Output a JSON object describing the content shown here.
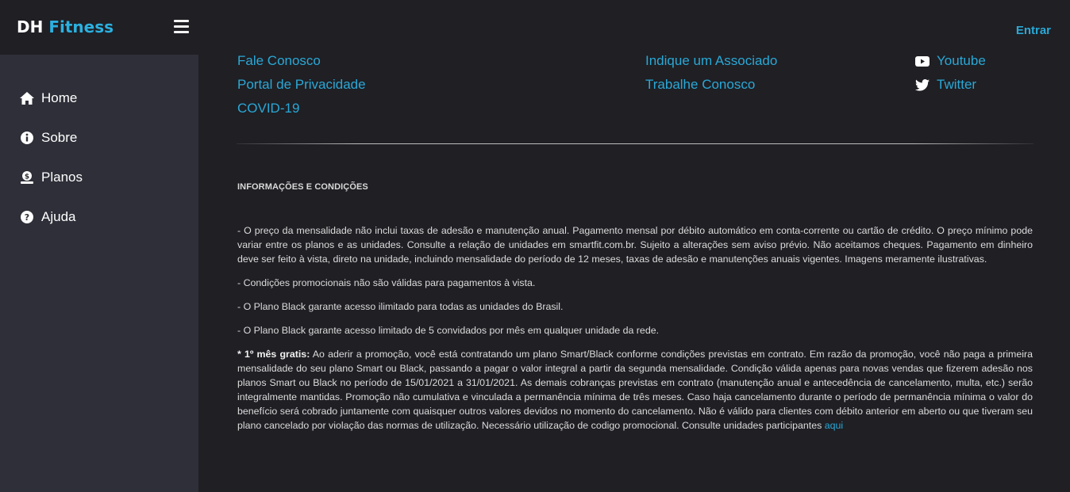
{
  "brand": {
    "part1": "DH",
    "part2": "Fitness"
  },
  "header": {
    "login_label": "Entrar"
  },
  "sidebar": {
    "items": [
      {
        "label": "Home",
        "icon": "home-icon"
      },
      {
        "label": "Sobre",
        "icon": "info-icon"
      },
      {
        "label": "Planos",
        "icon": "money-icon"
      },
      {
        "label": "Ajuda",
        "icon": "question-icon"
      }
    ]
  },
  "footer_links": {
    "col1": [
      "Fale Conosco",
      "Portal de Privacidade",
      "COVID-19"
    ],
    "col2": [
      "Indique um Associado",
      "Trabalhe Conosco"
    ],
    "social": [
      {
        "label": "Youtube",
        "icon": "youtube-icon"
      },
      {
        "label": "Twitter",
        "icon": "twitter-icon"
      }
    ]
  },
  "info": {
    "title": "INFORMAÇÕES E CONDIÇÕES",
    "p1": "- O preço da mensalidade não inclui taxas de adesão e manutenção anual. Pagamento mensal por débito automático em conta-corrente ou cartão de crédito. O preço mínimo pode variar entre os planos e as unidades. Consulte a relação de unidades em smartfit.com.br. Sujeito a alterações sem aviso prévio. Não aceitamos cheques. Pagamento em dinheiro deve ser feito à vista, direto na unidade, incluindo mensalidade do período de 12 meses, taxas de adesão e manutenções anuais vigentes. Imagens meramente ilustrativas.",
    "p2": "- Condições promocionais não são válidas para pagamentos à vista.",
    "p3": "- O Plano Black garante acesso ilimitado para todas as unidades do Brasil.",
    "p4": "- O Plano Black garante acesso limitado de 5 convidados por mês em qualquer unidade da rede.",
    "p5_strong": "* 1º mês gratis:",
    "p5_text": " Ao aderir a promoção, você está contratando um plano Smart/Black conforme condições previstas em contrato. Em razão da promoção, você não paga a primeira mensalidade do seu plano Smart ou Black, passando a pagar o valor integral a partir da segunda mensalidade. Condição válida apenas para novas vendas que fizerem adesão nos planos Smart ou Black no período de 15/01/2021 a 31/01/2021. As demais cobranças previstas em contrato (manutenção anual e antecedência de cancelamento, multa, etc.) serão integralmente mantidas. Promoção não cumulativa e vinculada a permanência mínima de três meses. Caso haja cancelamento durante o período de permanência mínima o valor do benefício será cobrado juntamente com quaisquer outros valores devidos no momento do cancelamento. Não é válido para clientes com débito anterior em aberto ou que tiveram seu plano cancelado por violação das normas de utilização. Necessário utilização de codigo promocional. Consulte unidades participantes ",
    "p5_link": "aqui"
  },
  "colors": {
    "accent": "#2aa8d6",
    "sidebar_bg": "#2e2f38",
    "page_bg": "#1f1f24"
  }
}
